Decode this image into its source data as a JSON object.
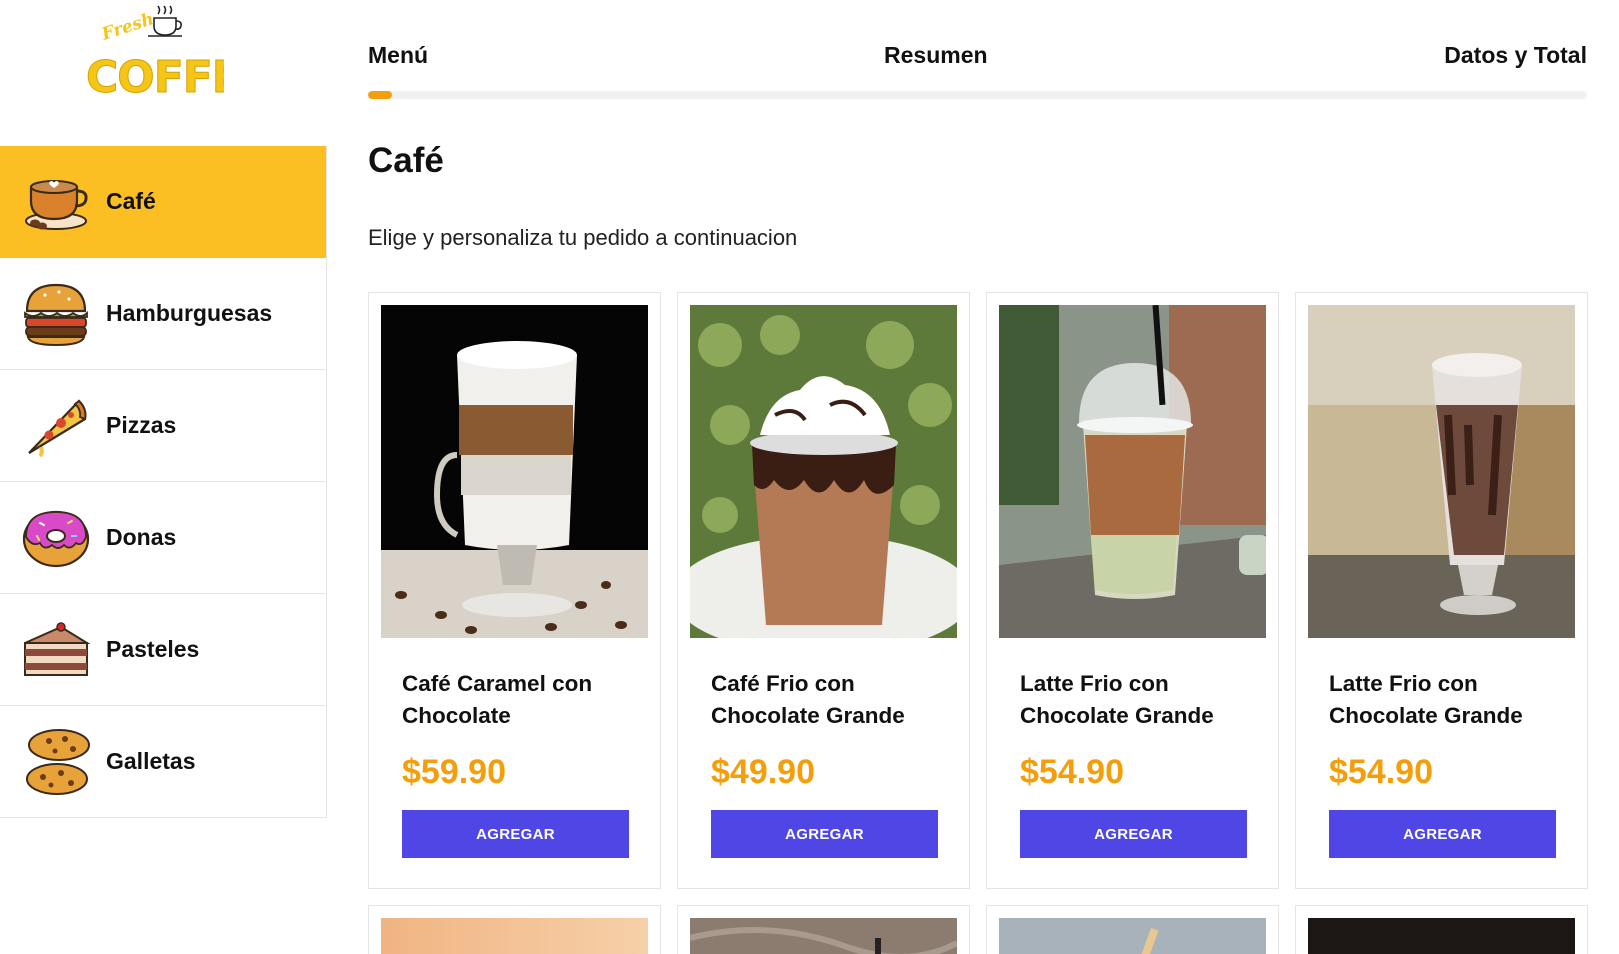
{
  "brand": {
    "logo_alt": "Fresh Coffee"
  },
  "sidebar": {
    "items": [
      {
        "label": "Café",
        "icon": "coffee-cup-icon",
        "active": true
      },
      {
        "label": "Hamburguesas",
        "icon": "burger-icon",
        "active": false
      },
      {
        "label": "Pizzas",
        "icon": "pizza-icon",
        "active": false
      },
      {
        "label": "Donas",
        "icon": "donut-icon",
        "active": false
      },
      {
        "label": "Pasteles",
        "icon": "cake-icon",
        "active": false
      },
      {
        "label": "Galletas",
        "icon": "cookies-icon",
        "active": false
      }
    ]
  },
  "steps": {
    "items": [
      "Menú",
      "Resumen",
      "Datos y Total"
    ],
    "progress_fraction": 0.02
  },
  "main": {
    "title": "Café",
    "subtitle": "Elige y personaliza tu pedido a continuacion"
  },
  "products": [
    {
      "name": "Café Caramel con Chocolate",
      "price": "$59.90",
      "button": "AGREGAR"
    },
    {
      "name": "Café Frio con Chocolate Grande",
      "price": "$49.90",
      "button": "AGREGAR"
    },
    {
      "name": "Latte Frio con Chocolate Grande",
      "price": "$54.90",
      "button": "AGREGAR"
    },
    {
      "name": "Latte Frio con Chocolate Grande",
      "price": "$54.90",
      "button": "AGREGAR"
    }
  ],
  "colors": {
    "accent_yellow": "#fbbf24",
    "price_orange": "#f59e0b",
    "button_indigo": "#4f46e5"
  }
}
